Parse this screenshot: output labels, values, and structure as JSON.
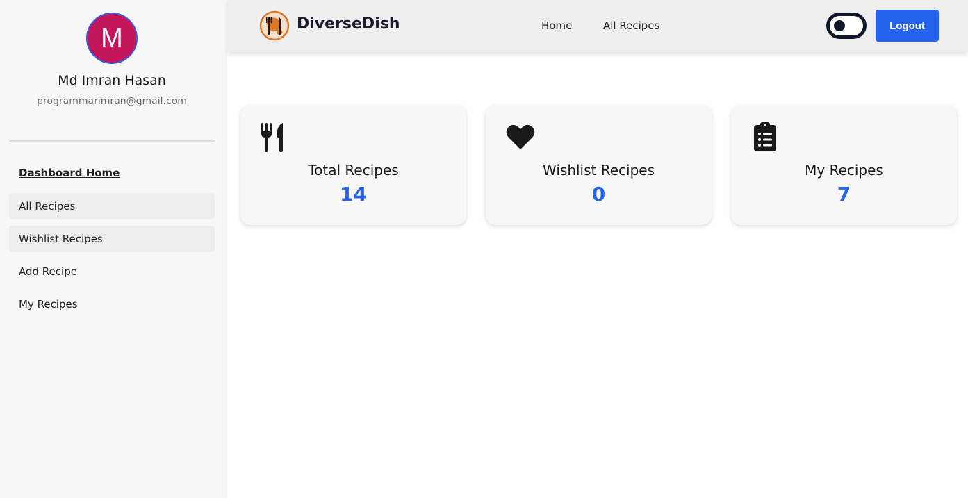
{
  "sidebar": {
    "avatar_initial": "M",
    "user_name": "Md Imran Hasan",
    "user_email": "programmarimran@gmail.com",
    "items": [
      {
        "label": "Dashboard Home"
      },
      {
        "label": "All Recipes"
      },
      {
        "label": "Wishlist Recipes"
      },
      {
        "label": "Add Recipe"
      },
      {
        "label": "My Recipes"
      }
    ]
  },
  "navbar": {
    "brand": "DiverseDish",
    "links": [
      {
        "label": "Home"
      },
      {
        "label": "All Recipes"
      }
    ],
    "logout_label": "Logout"
  },
  "cards": [
    {
      "icon": "utensils-icon",
      "title": "Total Recipes",
      "value": "14"
    },
    {
      "icon": "heart-icon",
      "title": "Wishlist Recipes",
      "value": "0"
    },
    {
      "icon": "clipboard-list-icon",
      "title": "My Recipes",
      "value": "7"
    }
  ],
  "colors": {
    "accent": "#2563eb",
    "avatar_bg": "#c2185b",
    "toggle": "#0f172a"
  }
}
